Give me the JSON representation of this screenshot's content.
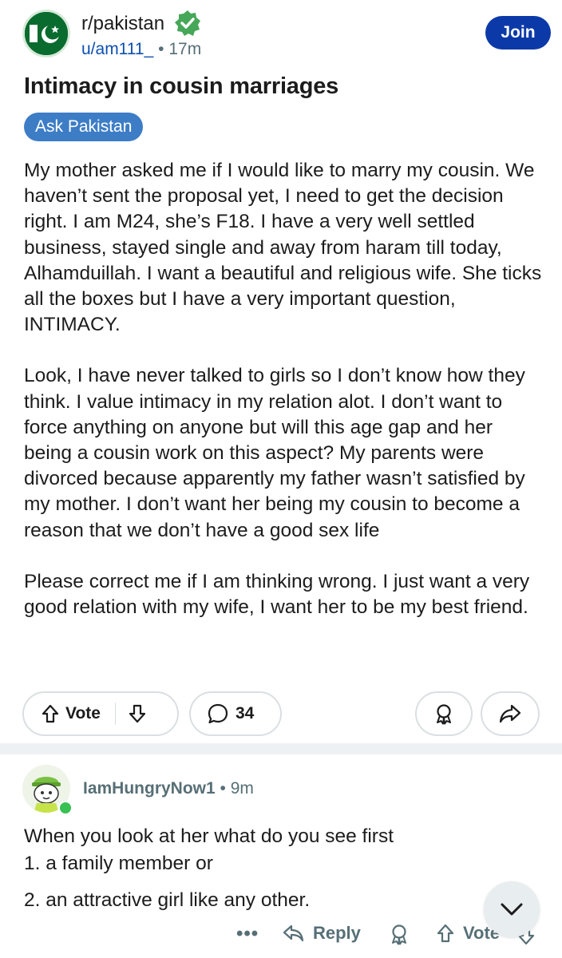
{
  "post": {
    "subreddit": "r/pakistan",
    "author": "u/am111_",
    "separator": "•",
    "age": "17m",
    "join_label": "Join",
    "title": "Intimacy in cousin marriages",
    "flair": "Ask Pakistan",
    "body": [
      "My mother asked me if I would like to marry my cousin. We haven’t sent the proposal yet, I need to get the decision right. I am M24, she’s F18. I have a very well settled business, stayed single and away from haram till today, Alhamduillah. I want a beautiful and religious wife. She ticks all the boxes but I have a very important question, INTIMACY.",
      "Look, I have never talked to girls so I don’t know how they think. I value intimacy in my relation alot. I don’t want to force anything on anyone but will this age gap and her being a cousin work on this aspect? My parents were divorced because apparently my father wasn’t satisfied by my mother. I don’t want her being my cousin to become a reason that we don’t have a good sex life",
      "Please correct me if I am thinking wrong. I just want a very good relation with my wife, I want her to be my best friend."
    ],
    "vote_label": "Vote",
    "comment_count": "34"
  },
  "comment": {
    "author": "IamHungryNow1",
    "separator": "•",
    "age": "9m",
    "lines": [
      "When you look at her what do you see first",
      "1. a family member or",
      "2. an attractive girl like any other."
    ],
    "more_label": "•••",
    "reply_label": "Reply",
    "vote_label": "Vote"
  },
  "colors": {
    "join_button": "#0b3aa8",
    "flair": "#3d7dc6",
    "verified_badge": "#46a758",
    "author_link": "#0e4fb0",
    "muted": "#576f76"
  }
}
